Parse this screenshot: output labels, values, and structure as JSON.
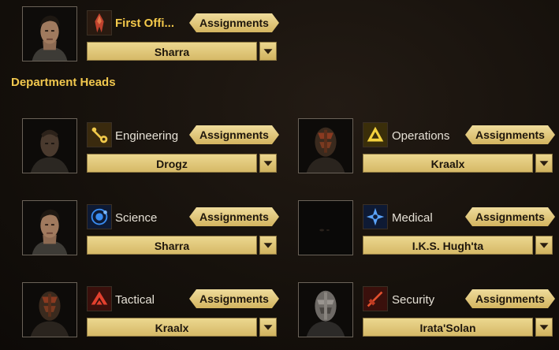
{
  "first_officer": {
    "label": "First Offi...",
    "assignments_label": "Assignments",
    "officer": "Sharra",
    "icon": "first-officer-emblem-icon"
  },
  "section_title": "Department Heads",
  "departments": [
    {
      "label": "Engineering",
      "assignments_label": "Assignments",
      "officer": "Drogz",
      "icon": "wrench-icon"
    },
    {
      "label": "Operations",
      "assignments_label": "Assignments",
      "officer": "Kraalx",
      "icon": "triangle-icon"
    },
    {
      "label": "Science",
      "assignments_label": "Assignments",
      "officer": "Sharra",
      "icon": "science-orbit-icon"
    },
    {
      "label": "Medical",
      "assignments_label": "Assignments",
      "officer": "I.K.S. Hugh'ta",
      "icon": "medical-star-icon"
    },
    {
      "label": "Tactical",
      "assignments_label": "Assignments",
      "officer": "Kraalx",
      "icon": "tactical-chevron-icon"
    },
    {
      "label": "Security",
      "assignments_label": "Assignments",
      "officer": "Irata'Solan",
      "icon": "dagger-icon"
    }
  ],
  "colors": {
    "gold": "#f2c84e",
    "button": "#e2c676",
    "background": "#16110c"
  }
}
